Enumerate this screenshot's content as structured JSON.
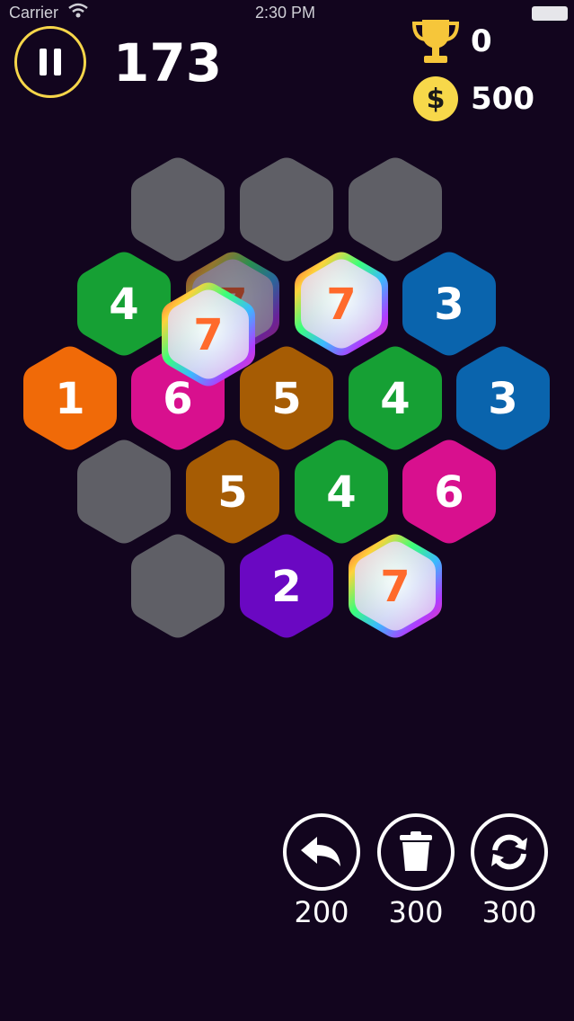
{
  "status_bar": {
    "carrier": "Carrier",
    "time": "2:30 PM"
  },
  "header": {
    "score": "173",
    "best_score": "0",
    "coins": "500",
    "coin_symbol": "$",
    "icons": {
      "pause": "pause-icon",
      "trophy": "trophy-icon",
      "coin": "coin-icon"
    }
  },
  "board": {
    "tiles": [
      {
        "label": "",
        "color": "#5f5f66"
      },
      {
        "label": "",
        "color": "#5f5f66"
      },
      {
        "label": "",
        "color": "#5f5f66"
      },
      {
        "label": "4",
        "color": "#16a034"
      },
      {
        "label": "7",
        "color": "#cfc9c0"
      },
      {
        "label": "7",
        "color": "#e6dce8"
      },
      {
        "label": "3",
        "color": "#0a64ad"
      },
      {
        "label": "1",
        "color": "#f06a08"
      },
      {
        "label": "6",
        "color": "#d8108e"
      },
      {
        "label": "5",
        "color": "#a65c04"
      },
      {
        "label": "4",
        "color": "#16a034"
      },
      {
        "label": "3",
        "color": "#0a64ad"
      },
      {
        "label": "",
        "color": "#5f5f66"
      },
      {
        "label": "5",
        "color": "#a65c04"
      },
      {
        "label": "4",
        "color": "#16a034"
      },
      {
        "label": "6",
        "color": "#d8108e"
      },
      {
        "label": "",
        "color": "#5f5f66"
      },
      {
        "label": "2",
        "color": "#6a08c2"
      },
      {
        "label": "7",
        "color": "#e6dce8"
      }
    ],
    "floating_tile": {
      "label": "7",
      "color": "#e6dce8"
    }
  },
  "powerups": [
    {
      "name": "undo",
      "icon": "undo-arrow-icon",
      "cost": "200"
    },
    {
      "name": "trash",
      "icon": "trash-icon",
      "cost": "300"
    },
    {
      "name": "shuffle",
      "icon": "refresh-icon",
      "cost": "300"
    }
  ],
  "colors": {
    "background": "#12051e",
    "accent_gold": "#f6d64a",
    "empty_tile": "#5f5f66"
  }
}
